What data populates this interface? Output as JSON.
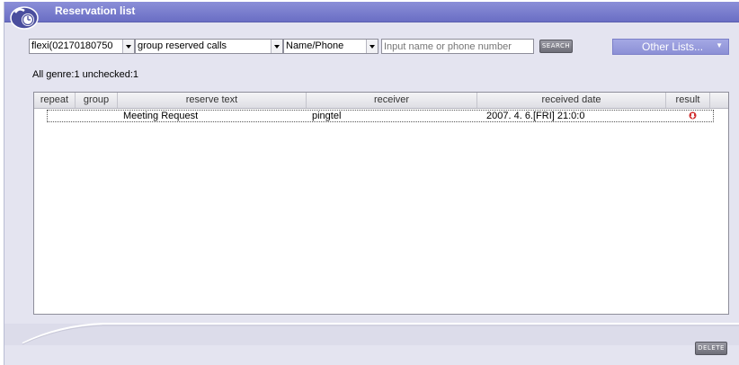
{
  "window": {
    "title": "Reservation list"
  },
  "filters": {
    "account": "flexi(02170180750",
    "call_type": "group reserved calls",
    "search_field": "Name/Phone",
    "search_placeholder": "Input name or phone number",
    "search_label": "SEARCH",
    "other_lists_label": "Other Lists..."
  },
  "status": "All genre:1  unchecked:1",
  "table": {
    "columns": [
      "repeat",
      "group",
      "reserve text",
      "receiver",
      "received date",
      "result"
    ],
    "rows": [
      {
        "repeat": "",
        "group": "",
        "reserve_text": "Meeting Request",
        "receiver": "pingtel",
        "received_date": "2007. 4. 6.[FRI] 21:0:0",
        "result_icon": "alert-icon"
      }
    ]
  },
  "footer": {
    "delete_label": "DELETE"
  },
  "colors": {
    "titlebar": "#6a6ec4",
    "panel": "#e4e4f0",
    "accent": "#8c90d6"
  }
}
